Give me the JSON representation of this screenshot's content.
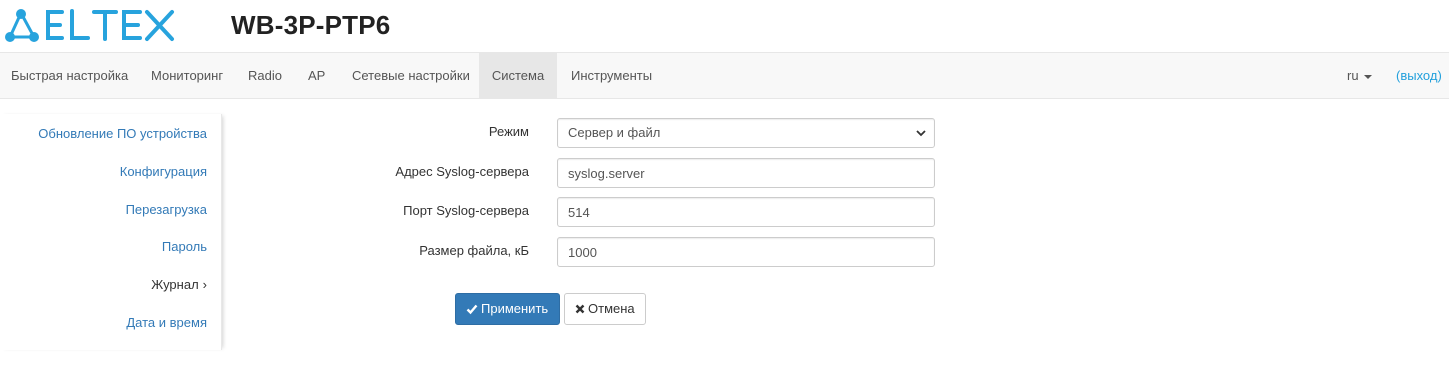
{
  "header": {
    "logo_text": "ELTEX",
    "device_title": "WB-3P-PTP6",
    "brand_color": "#27a3dd"
  },
  "nav": {
    "items": [
      {
        "label": "Быстрая настройка"
      },
      {
        "label": "Мониторинг"
      },
      {
        "label": "Radio"
      },
      {
        "label": "AP"
      },
      {
        "label": "Сетевые настройки"
      },
      {
        "label": "Система",
        "active": true
      },
      {
        "label": "Инструменты"
      }
    ],
    "lang": "ru",
    "logout": "(выход)"
  },
  "sidebar": {
    "items": [
      {
        "label": "Обновление ПО устройства"
      },
      {
        "label": "Конфигурация"
      },
      {
        "label": "Перезагрузка"
      },
      {
        "label": "Пароль"
      },
      {
        "label": "Журнал",
        "active": true,
        "chevron": "›"
      },
      {
        "label": "Дата и время"
      }
    ]
  },
  "form": {
    "mode_label": "Режим",
    "mode_value": "Сервер и файл",
    "server_label": "Адрес Syslog-сервера",
    "server_value": "syslog.server",
    "port_label": "Порт Syslog-сервера",
    "port_value": "514",
    "size_label": "Размер файла, кБ",
    "size_value": "1000"
  },
  "buttons": {
    "apply_label": "Применить",
    "apply_icon": "check-icon",
    "cancel_label": "Отмена",
    "cancel_icon": "times-icon"
  }
}
